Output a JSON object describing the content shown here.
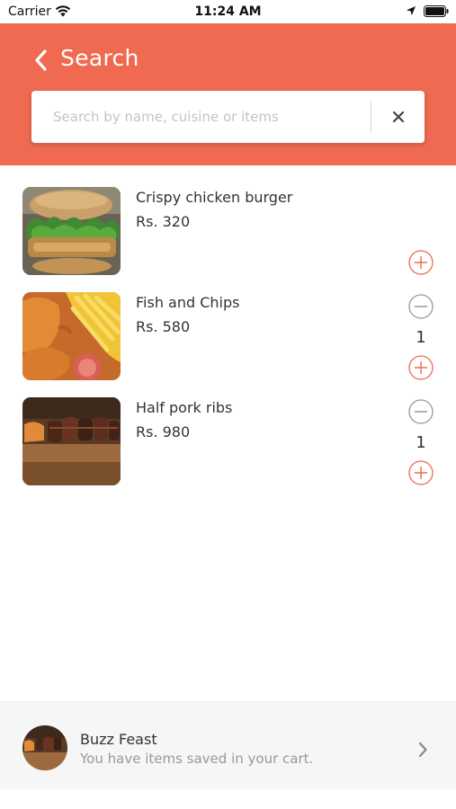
{
  "status_bar": {
    "carrier": "Carrier",
    "time": "11:24 AM"
  },
  "header": {
    "title": "Search",
    "search_placeholder": "Search by name, cuisine or items",
    "search_value": ""
  },
  "colors": {
    "accent": "#ef6a50",
    "background": "#ffffff"
  },
  "items": [
    {
      "name": "Crispy chicken burger",
      "price": "Rs. 320",
      "quantity": null,
      "image": "burger-photo"
    },
    {
      "name": "Fish and Chips",
      "price": "Rs. 580",
      "quantity": "1",
      "image": "fish-and-chips-photo"
    },
    {
      "name": "Half pork ribs",
      "price": "Rs. 980",
      "quantity": "1",
      "image": "pork-ribs-photo"
    }
  ],
  "cart": {
    "restaurant": "Buzz Feast",
    "message": "You have items saved in your cart."
  }
}
